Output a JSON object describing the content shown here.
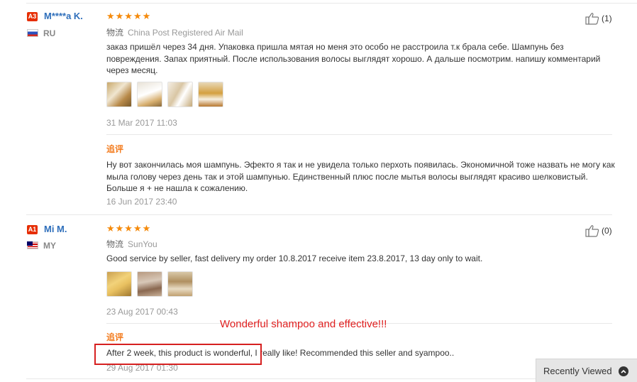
{
  "reviews": [
    {
      "badge": "A3",
      "name": "M****a K.",
      "country": "RU",
      "stars": "★★★★★",
      "shipping_label": "物流",
      "shipping": "China Post Registered Air Mail",
      "text": "заказ пришёл через 34 дня. Упаковка пришла мятая но меня это особо не расстроила т.к брала себе. Шампунь без повреждения. Запах приятный. После использования волосы выглядят хорошо. А дальше посмотрим. напишу комментарий через месяц.",
      "date": "31 Mar 2017 11:03",
      "likes": "(1)",
      "additional_label": "追评",
      "additional_text": "Ну вот закончилась моя шампунь. Эфекто я так и не увидела только перхоть появилась. Экономичной тоже назвать не могу как мыла голову через день так и этой шампунью. Единственный плюс после мытья волосы выглядят красиво шелковистый. Больше я + не нашла к сожалению.",
      "additional_date": "16 Jun 2017 23:40",
      "photos": [
        "photo-1",
        "photo-2",
        "photo-3",
        "photo-4"
      ]
    },
    {
      "badge": "A1",
      "name": "Mi M.",
      "country": "MY",
      "stars": "★★★★★",
      "shipping_label": "物流",
      "shipping": "SunYou",
      "text": "Good service by seller, fast delivery my order 10.8.2017 receive item 23.8.2017, 13 day only to wait.",
      "date": "23 Aug 2017 00:43",
      "likes": "(0)",
      "additional_label": "追评",
      "additional_text": "After 2 week, this product is wonderful, I really like! Recommended this seller and syampoo..",
      "additional_date": "29 Aug 2017 01:30",
      "photos": [
        "photo-1",
        "photo-2",
        "photo-3"
      ]
    }
  ],
  "annotation_note": "Wonderful shampoo and effective!!!",
  "recently_viewed": "Recently Viewed",
  "colors": {
    "accent_orange": "#f37b1d",
    "star": "#f58a0b",
    "name_blue": "#2f6fbb",
    "badge_red": "#e62e04",
    "annotation_red": "#e02020"
  }
}
